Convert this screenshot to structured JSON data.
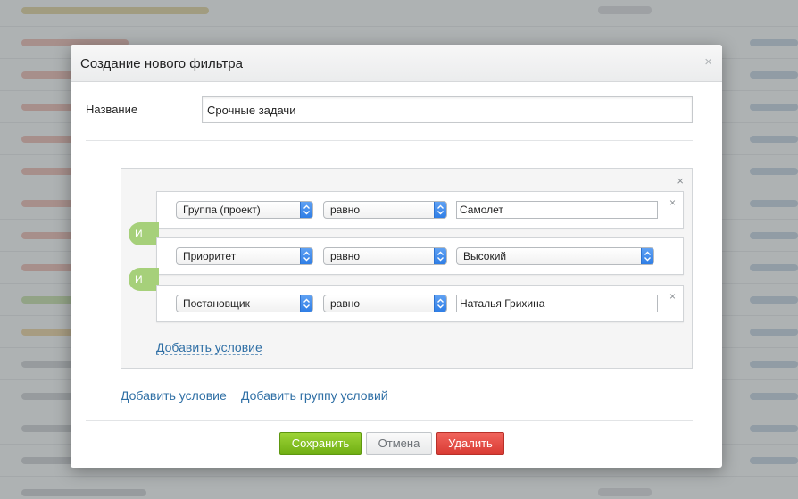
{
  "dialog": {
    "title": "Создание нового фильтра",
    "close_glyph": "×"
  },
  "name_field": {
    "label": "Название",
    "value": "Срочные задачи"
  },
  "group": {
    "close_glyph": "×",
    "operator_label": "И",
    "conditions": [
      {
        "field": "Группа (проект)",
        "operator": "равно",
        "value": "Самолет",
        "value_type": "input"
      },
      {
        "field": "Приоритет",
        "operator": "равно",
        "value": "Высокий",
        "value_type": "select"
      },
      {
        "field": "Постановщик",
        "operator": "равно",
        "value": "Наталья Грихина",
        "value_type": "input"
      }
    ],
    "add_condition_label": "Добавить условие"
  },
  "links": {
    "add_condition": "Добавить условие",
    "add_condition_group": "Добавить группу условий"
  },
  "buttons": {
    "save": "Сохранить",
    "cancel": "Отмена",
    "delete": "Удалить"
  },
  "colors": {
    "save": "#7dbb1e",
    "delete": "#e04a42",
    "and_pill": "#a6d07a",
    "select_arrow": "#3d87ec",
    "link": "#2f6fa5"
  }
}
